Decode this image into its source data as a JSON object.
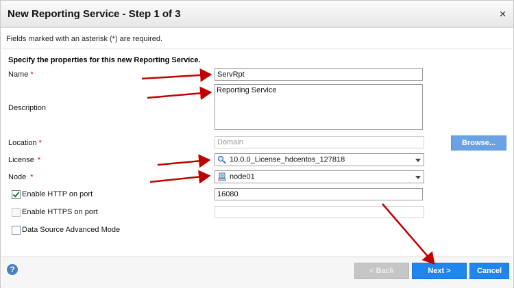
{
  "dialog": {
    "title": "New Reporting Service - Step 1 of 3",
    "close_glyph": "✕",
    "required_note": "Fields marked with an asterisk (*) are required.",
    "section_title": "Specify the properties for this new Reporting Service."
  },
  "form": {
    "name": {
      "label": "Name",
      "required_mark": "*",
      "value": "ServRpt"
    },
    "description": {
      "label": "Description",
      "value": "Reporting Service"
    },
    "location": {
      "label": "Location",
      "required_mark": "*",
      "placeholder": "Domain",
      "browse_label": "Browse..."
    },
    "license": {
      "label": "License",
      "required_mark": "*",
      "value": "10.0.0_License_hdcentos_127818",
      "icon": "license-key-icon"
    },
    "node": {
      "label": "Node",
      "required_mark": "*",
      "value": "node01",
      "icon": "server-node-icon"
    },
    "enable_http": {
      "label": "Enable HTTP on port",
      "checked": true,
      "value": "16080"
    },
    "enable_https": {
      "label": "Enable HTTPS on port",
      "checked": false,
      "value": ""
    },
    "data_source_advanced": {
      "label": "Data Source Advanced Mode",
      "checked": false
    }
  },
  "footer": {
    "help_glyph": "?",
    "back_label": "< Back",
    "next_label": "Next >",
    "cancel_label": "Cancel"
  },
  "colors": {
    "primary_button": "#1f86f0",
    "browse_button": "#6aa3e4",
    "disabled_button": "#c6c6c6",
    "required_star": "#d00000",
    "annotation_arrow": "#c00000"
  }
}
